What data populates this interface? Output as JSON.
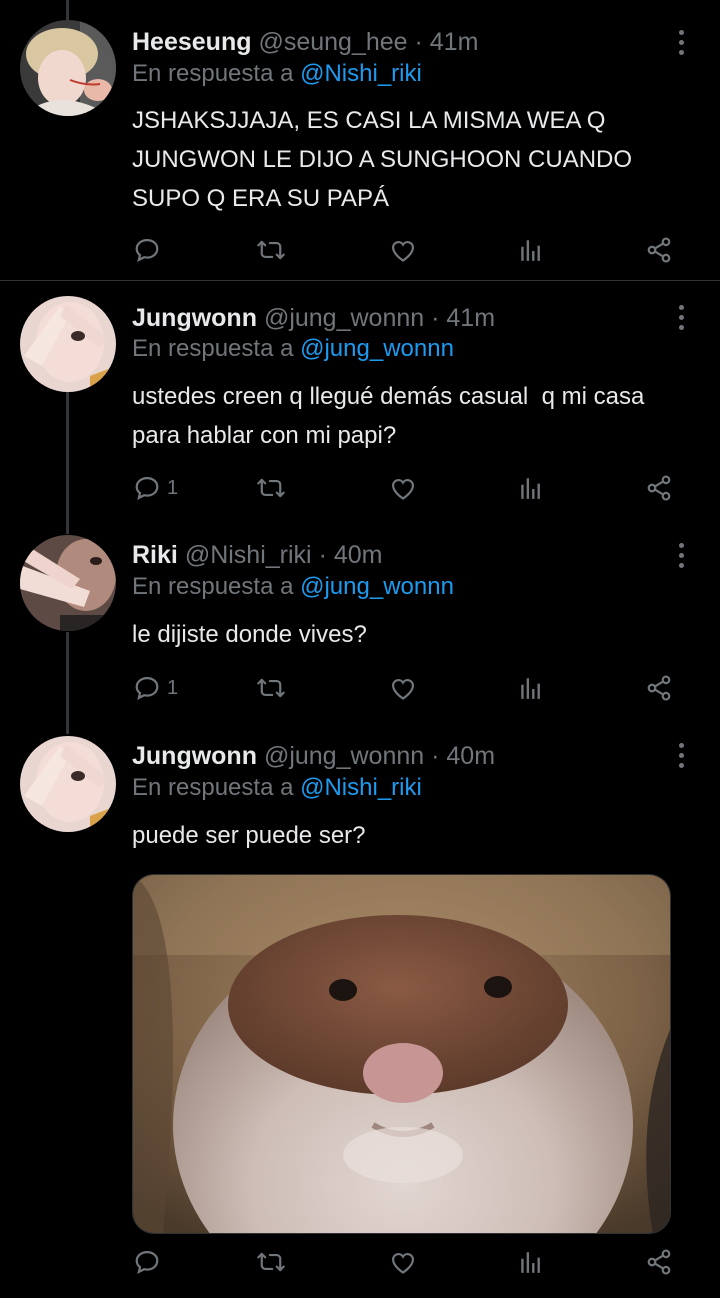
{
  "tweets": [
    {
      "name": "Heeseung",
      "handle": "@seung_hee",
      "sep": "·",
      "time": "41m",
      "reply_prefix": "En respuesta a",
      "reply_to": "@Nishi_riki",
      "lines": [
        "JSHAKSJJAJA, ES CASI LA MISMA WEA Q",
        "JUNGWON LE DIJO A SUNGHOON CUANDO",
        "SUPO Q ERA SU PAPÁ"
      ],
      "reply_count": ""
    },
    {
      "name": "Jungwonn",
      "handle": "@jung_wonnn",
      "sep": "·",
      "time": "41m",
      "reply_prefix": "En respuesta a",
      "reply_to": "@jung_wonnn",
      "lines": [
        "ustedes creen q llegué demás casual  q mi casa",
        "para hablar con mi papi?"
      ],
      "reply_count": "1"
    },
    {
      "name": "Riki",
      "handle": "@Nishi_riki",
      "sep": "·",
      "time": "40m",
      "reply_prefix": "En respuesta a",
      "reply_to": "@jung_wonnn",
      "lines": [
        "le dijiste donde vives?"
      ],
      "reply_count": "1"
    },
    {
      "name": "Jungwonn",
      "handle": "@jung_wonnn",
      "sep": "·",
      "time": "40m",
      "reply_prefix": "En respuesta a",
      "reply_to": "@Nishi_riki",
      "lines": [
        "puede ser puede ser?"
      ],
      "reply_count": "",
      "media": "hamster-photo"
    }
  ],
  "icons": {
    "reply": "reply-icon",
    "retweet": "retweet-icon",
    "like": "heart-icon",
    "views": "views-icon",
    "share": "share-icon",
    "more": "more-icon"
  },
  "colors": {
    "background": "#000000",
    "text": "#e7e9ea",
    "muted": "#71767b",
    "accent": "#1d9bf0"
  }
}
